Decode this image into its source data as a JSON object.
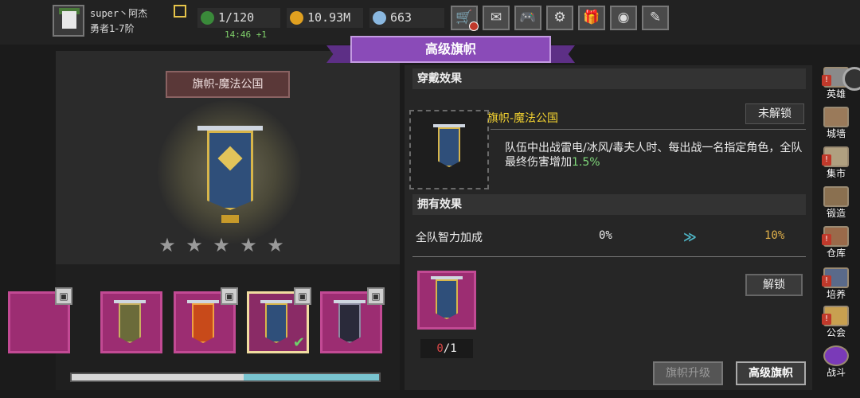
{
  "player": {
    "name": "super丶阿杰",
    "rank": "勇者1-7阶"
  },
  "stats": {
    "energy": "1/120",
    "energy_timer": "14:46 +1",
    "gold": "10.93M",
    "gems": "663"
  },
  "top_buttons": [
    {
      "icon": "shop-cart-icon",
      "glyph": "🛒"
    },
    {
      "icon": "mail-icon",
      "glyph": "✉"
    },
    {
      "icon": "gamepad-icon",
      "glyph": "🎮"
    },
    {
      "icon": "gear-icon",
      "glyph": "⚙"
    },
    {
      "icon": "gift-icon",
      "glyph": "🎁"
    },
    {
      "icon": "color-wheel-icon",
      "glyph": "◉"
    },
    {
      "icon": "feather-icon",
      "glyph": "✎"
    }
  ],
  "banner_title": "高级旗帜",
  "left": {
    "item_name": "旗帜-魔法公国",
    "stars_total": 5,
    "stars_filled": 0,
    "star_glyph": "★",
    "slots": [
      {
        "id": "slot-1",
        "locked": false,
        "selected": false
      },
      {
        "id": "slot-2",
        "locked": false,
        "selected": false
      },
      {
        "id": "slot-3",
        "locked": true,
        "selected": false
      },
      {
        "id": "slot-4",
        "locked": true,
        "selected": true,
        "owned": true
      },
      {
        "id": "slot-5",
        "locked": true,
        "selected": false
      }
    ],
    "scroll_fraction": 0.44
  },
  "right": {
    "wear_header": "穿戴效果",
    "equip_name": "旗帜-魔法公国",
    "locked_label": "未解锁",
    "desc_main": "队伍中出战雷电/冰风/毒夫人时、每出战一名指定角色，全队最终伤害增加",
    "desc_value": "1.5%",
    "own_header": "拥有效果",
    "own_stat_name": "全队智力加成",
    "own_current": "0%",
    "own_arrow": "≫",
    "own_next": "10%",
    "mat_have": "0",
    "mat_need": "/1",
    "unlock_label": "解锁",
    "upgrade_label": "旗帜升级",
    "advanced_label": "高级旗帜"
  },
  "sidenav": [
    {
      "label": "英雄",
      "alert": true
    },
    {
      "label": "城墙",
      "alert": false
    },
    {
      "label": "集市",
      "alert": true
    },
    {
      "label": "锻造",
      "alert": false
    },
    {
      "label": "仓库",
      "alert": true
    },
    {
      "label": "培养",
      "alert": true
    },
    {
      "label": "公会",
      "alert": true
    },
    {
      "label": "战斗",
      "alert": false
    }
  ],
  "colors": {
    "accent_purple": "#8a4bb8",
    "slot_magenta": "#9c2d72",
    "highlight_yellow": "#f3d230",
    "positive_green": "#7fd87a",
    "negative_red": "#e04848"
  }
}
